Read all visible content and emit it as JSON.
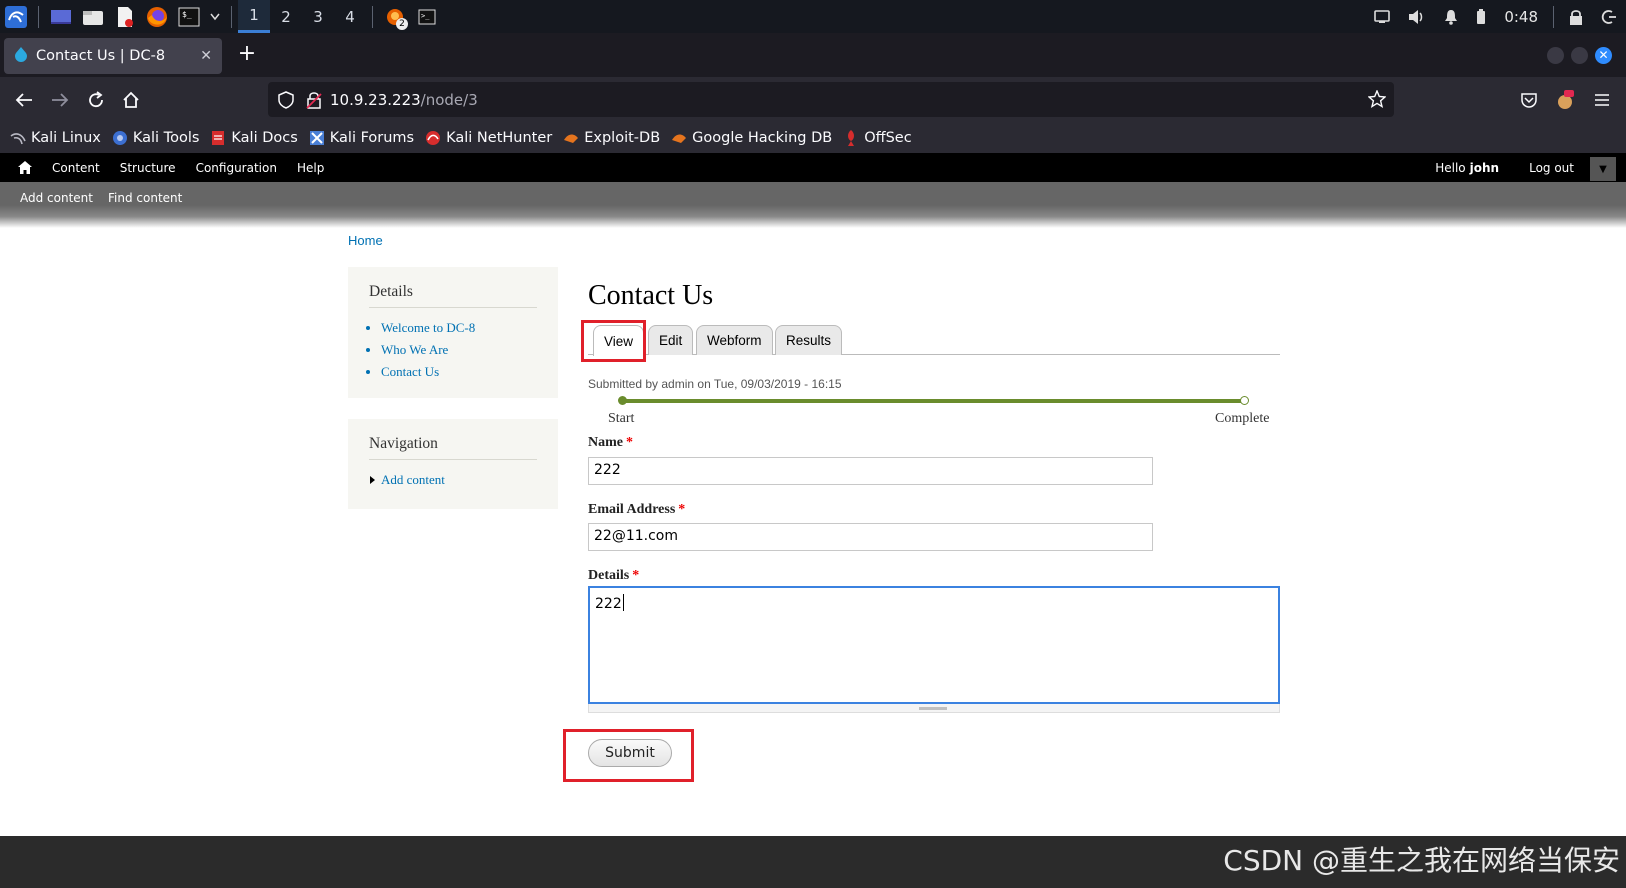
{
  "os": {
    "workspaces": [
      "1",
      "2",
      "3",
      "4"
    ],
    "active_workspace": "1",
    "badge_count": "2",
    "clock": "0:48"
  },
  "browser": {
    "tab_title": "Contact Us | DC-8",
    "url_host": "10.9.23.223",
    "url_path": "/node/3",
    "bookmarks": [
      "Kali Linux",
      "Kali Tools",
      "Kali Docs",
      "Kali Forums",
      "Kali NetHunter",
      "Exploit-DB",
      "Google Hacking DB",
      "OffSec"
    ]
  },
  "toolbar": {
    "items": [
      "Content",
      "Structure",
      "Configuration",
      "Help"
    ],
    "hello": "Hello",
    "user": "john",
    "logout": "Log out",
    "shortcuts": [
      "Add content",
      "Find content"
    ]
  },
  "breadcrumb": "Home",
  "sidebar": {
    "details_title": "Details",
    "details_links": [
      "Welcome to DC-8",
      "Who We Are",
      "Contact Us"
    ],
    "nav_title": "Navigation",
    "nav_links": [
      "Add content"
    ]
  },
  "main": {
    "title": "Contact Us",
    "tabs": [
      "View",
      "Edit",
      "Webform",
      "Results"
    ],
    "submitted": "Submitted by admin on Tue, 09/03/2019 - 16:15",
    "progress_start": "Start",
    "progress_end": "Complete",
    "name_label": "Name",
    "name_value": "222",
    "email_label": "Email Address",
    "email_value": "22@11.com",
    "details_label": "Details",
    "details_value": "222",
    "required_mark": "*",
    "submit_label": "Submit"
  },
  "watermark": "CSDN @重生之我在网络当保安",
  "colors": {
    "link": "#0071b3",
    "highlight": "#e0202a",
    "progress": "#6a8c2d",
    "focus": "#3b82e0"
  }
}
